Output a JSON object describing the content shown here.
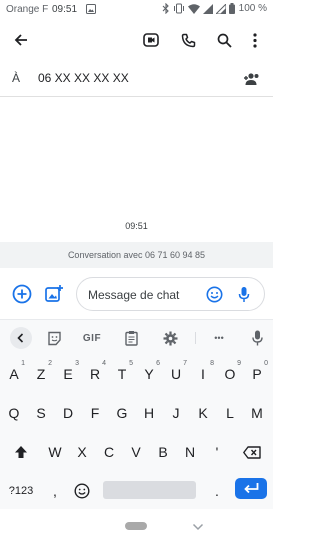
{
  "status_bar": {
    "carrier": "Orange F",
    "time": "09:51",
    "battery": "100 %"
  },
  "toolbar": {
    "back_icon": "arrow-left-icon",
    "actions": [
      "video-call-icon",
      "phone-icon",
      "search-icon",
      "more-vert-icon"
    ]
  },
  "recipient": {
    "label": "À",
    "value": "06 XX XX XX XX",
    "add_icon": "add-people-icon"
  },
  "conversation": {
    "timestamp": "09:51",
    "banner": "Conversation avec 06 71 60 94 85"
  },
  "compose": {
    "placeholder": "Message de chat",
    "add_icon": "plus-circle-icon",
    "gallery_icon": "add-photo-icon",
    "emoji_icon": "emoji-icon",
    "mic_icon": "mic-icon"
  },
  "keyboard": {
    "toolbar": {
      "back_icon": "chevron-left-icon",
      "sticker_icon": "sticker-icon",
      "gif_label": "GIF",
      "clipboard_icon": "clipboard-icon",
      "settings_icon": "gear-icon",
      "more_label": "•••",
      "mic_icon": "mic-icon"
    },
    "row1": [
      {
        "k": "A",
        "s": "1"
      },
      {
        "k": "Z",
        "s": "2"
      },
      {
        "k": "E",
        "s": "3"
      },
      {
        "k": "R",
        "s": "4"
      },
      {
        "k": "T",
        "s": "5"
      },
      {
        "k": "Y",
        "s": "6"
      },
      {
        "k": "U",
        "s": "7"
      },
      {
        "k": "I",
        "s": "8"
      },
      {
        "k": "O",
        "s": "9"
      },
      {
        "k": "P",
        "s": "0"
      }
    ],
    "row2": [
      "Q",
      "S",
      "D",
      "F",
      "G",
      "H",
      "J",
      "K",
      "L",
      "M"
    ],
    "row3": [
      "W",
      "X",
      "C",
      "V",
      "B",
      "N",
      "'"
    ],
    "shift_icon": "shift-icon",
    "backspace_icon": "backspace-icon",
    "row4": {
      "symbols": "?123",
      "comma": ",",
      "emoji_icon": "emoji-icon",
      "period": ".",
      "enter_icon": "enter-icon"
    },
    "accent_color": "#1a73e8"
  },
  "nav_bar": {
    "home_pill": "home-pill",
    "hide_keyboard_icon": "chevron-down-icon"
  }
}
